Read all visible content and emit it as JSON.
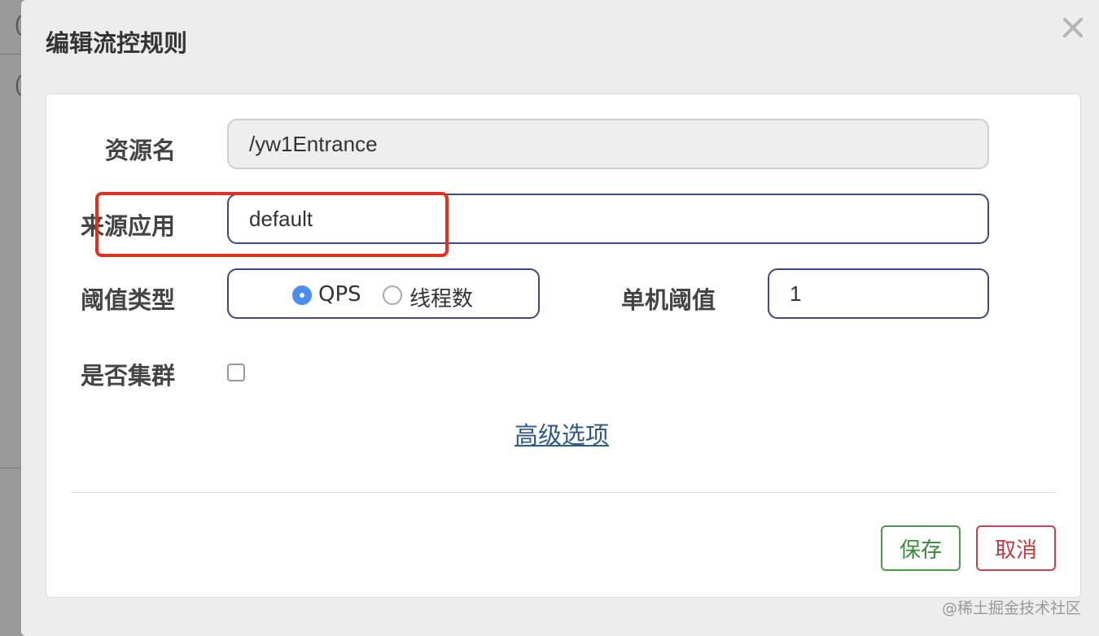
{
  "backdrop": {
    "glyph_top": "(",
    "glyph_bottom": "("
  },
  "modal": {
    "title": "编辑流控规则",
    "close_label": "×"
  },
  "form": {
    "resource": {
      "label": "资源名",
      "value": "/yw1Entrance"
    },
    "source_app": {
      "label": "来源应用",
      "value": "default"
    },
    "threshold_type": {
      "label": "阈值类型",
      "options": [
        {
          "label": "QPS",
          "selected": true
        },
        {
          "label": "线程数",
          "selected": false
        }
      ]
    },
    "single_threshold": {
      "label": "单机阈值",
      "value": "1"
    },
    "cluster": {
      "label": "是否集群",
      "checked": false
    },
    "advanced_link": "高级选项"
  },
  "footer": {
    "save_label": "保存",
    "cancel_label": "取消"
  },
  "colors": {
    "highlight": "#e0301e",
    "input_border": "#3a4a86",
    "radio_selected": "#4a8cf0",
    "save": "#3a8a3a",
    "cancel": "#c0393f",
    "link": "#2d5a86"
  },
  "watermark": "@稀土掘金技术社区"
}
